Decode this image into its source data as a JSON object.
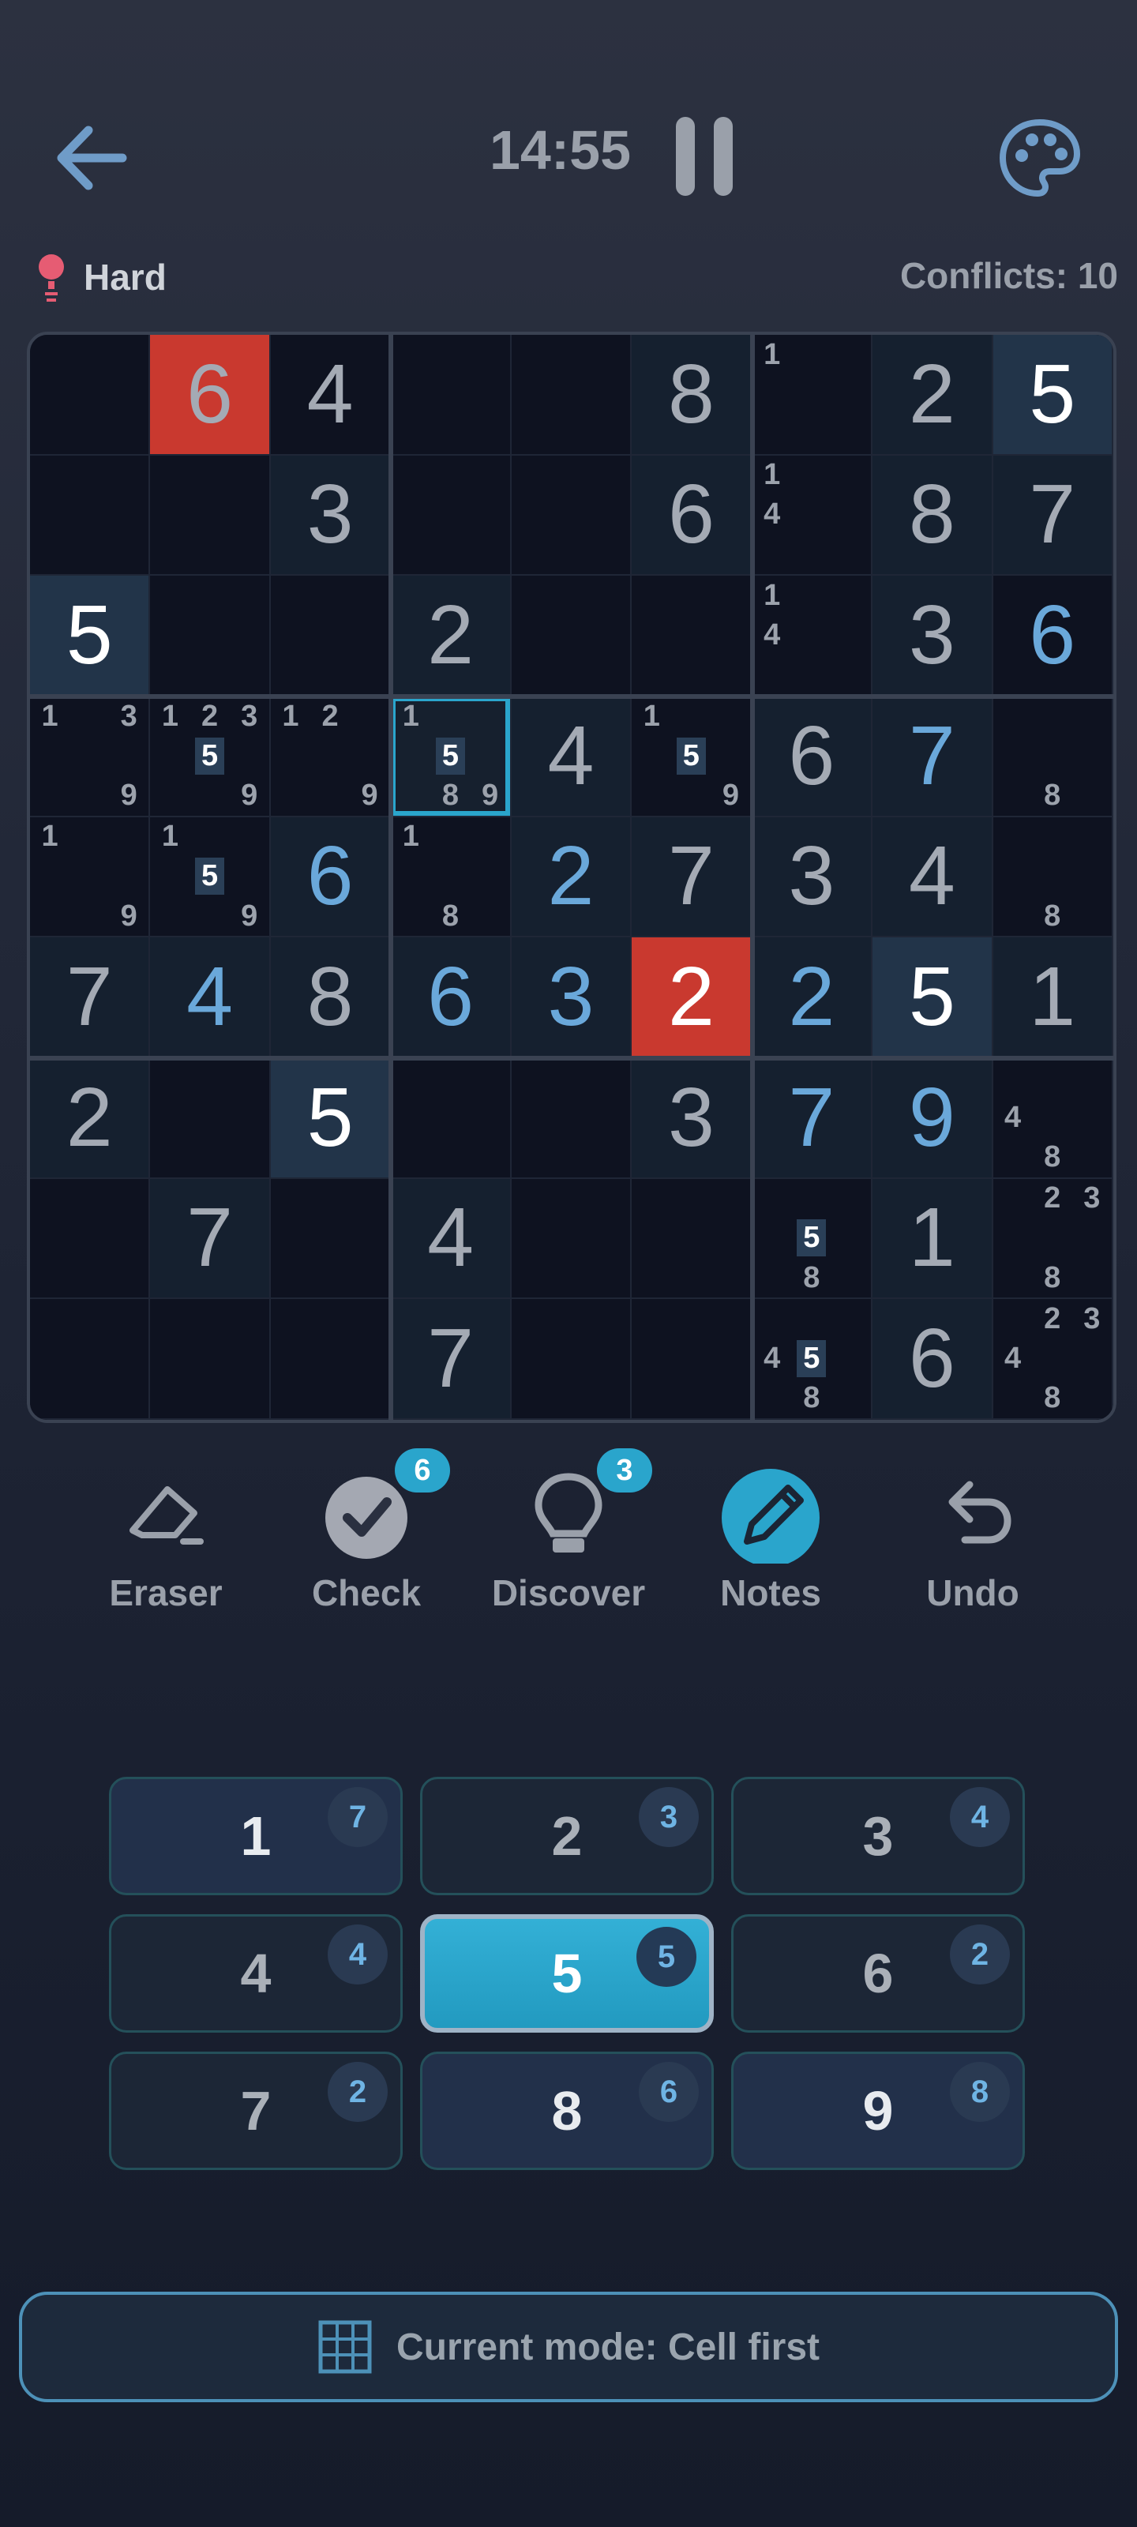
{
  "header": {
    "timer": "14:55",
    "difficulty": "Hard",
    "conflicts": "Conflicts: 10",
    "icons": [
      "back-arrow-icon",
      "pause-icon",
      "palette-icon",
      "bulb-pin-icon"
    ]
  },
  "board": {
    "cells": [
      [
        {
          "v": "",
          "s": ""
        },
        {
          "v": "6",
          "t": "given",
          "s": "conf"
        },
        {
          "v": "4",
          "t": "given"
        },
        {
          "v": ""
        },
        {
          "v": ""
        },
        {
          "v": "8",
          "t": "given",
          "s": "peer"
        },
        {
          "v": "",
          "n": [
            "1"
          ]
        },
        {
          "v": "2",
          "t": "given",
          "s": "peer"
        },
        {
          "v": "5",
          "t": "hl",
          "s": "same"
        }
      ],
      [
        {
          "v": ""
        },
        {
          "v": ""
        },
        {
          "v": "3",
          "t": "given",
          "s": "peer"
        },
        {
          "v": ""
        },
        {
          "v": ""
        },
        {
          "v": "6",
          "t": "given",
          "s": "peer"
        },
        {
          "v": "",
          "n": [
            "1",
            "4"
          ]
        },
        {
          "v": "8",
          "t": "given",
          "s": "peer"
        },
        {
          "v": "7",
          "t": "given",
          "s": "peer"
        }
      ],
      [
        {
          "v": "5",
          "t": "hl",
          "s": "same"
        },
        {
          "v": ""
        },
        {
          "v": ""
        },
        {
          "v": "2",
          "t": "given",
          "s": "peer"
        },
        {
          "v": ""
        },
        {
          "v": ""
        },
        {
          "v": "",
          "n": [
            "1",
            "4"
          ]
        },
        {
          "v": "3",
          "t": "given",
          "s": "peer"
        },
        {
          "v": "6",
          "t": "user"
        }
      ],
      [
        {
          "v": "",
          "n": [
            "1",
            "3",
            "9"
          ]
        },
        {
          "v": "",
          "n": [
            "1",
            "2",
            "3",
            "5",
            "9"
          ]
        },
        {
          "v": "",
          "n": [
            "1",
            "2",
            "9"
          ]
        },
        {
          "v": "",
          "n": [
            "1",
            "5",
            "8",
            "9"
          ],
          "s": "sel"
        },
        {
          "v": "4",
          "t": "given",
          "s": "peer"
        },
        {
          "v": "",
          "n": [
            "1",
            "5",
            "9"
          ]
        },
        {
          "v": "6",
          "t": "given",
          "s": "peer"
        },
        {
          "v": "7",
          "t": "user",
          "s": "peer"
        },
        {
          "v": "",
          "n": [
            "8"
          ]
        }
      ],
      [
        {
          "v": "",
          "n": [
            "1",
            "9"
          ]
        },
        {
          "v": "",
          "n": [
            "1",
            "5",
            "9"
          ]
        },
        {
          "v": "6",
          "t": "user",
          "s": "peer"
        },
        {
          "v": "",
          "n": [
            "1",
            "8"
          ]
        },
        {
          "v": "2",
          "t": "user",
          "s": "peer"
        },
        {
          "v": "7",
          "t": "given",
          "s": "peer"
        },
        {
          "v": "3",
          "t": "given",
          "s": "peer"
        },
        {
          "v": "4",
          "t": "given",
          "s": "peer"
        },
        {
          "v": "",
          "n": [
            "8"
          ]
        }
      ],
      [
        {
          "v": "7",
          "t": "given",
          "s": "peer"
        },
        {
          "v": "4",
          "t": "user",
          "s": "peer"
        },
        {
          "v": "8",
          "t": "given",
          "s": "peer"
        },
        {
          "v": "6",
          "t": "user",
          "s": "peer"
        },
        {
          "v": "3",
          "t": "user",
          "s": "peer"
        },
        {
          "v": "2",
          "t": "hl",
          "s": "conf"
        },
        {
          "v": "2",
          "t": "user",
          "s": "peer"
        },
        {
          "v": "5",
          "t": "hl",
          "s": "same"
        },
        {
          "v": "1",
          "t": "given",
          "s": "peer"
        }
      ],
      [
        {
          "v": "2",
          "t": "given",
          "s": "peer"
        },
        {
          "v": ""
        },
        {
          "v": "5",
          "t": "hl",
          "s": "same"
        },
        {
          "v": ""
        },
        {
          "v": ""
        },
        {
          "v": "3",
          "t": "given",
          "s": "peer"
        },
        {
          "v": "7",
          "t": "user",
          "s": "peer"
        },
        {
          "v": "9",
          "t": "user",
          "s": "peer"
        },
        {
          "v": "",
          "n": [
            "4",
            "8"
          ]
        }
      ],
      [
        {
          "v": ""
        },
        {
          "v": "7",
          "t": "given",
          "s": "peer"
        },
        {
          "v": ""
        },
        {
          "v": "4",
          "t": "given",
          "s": "peer"
        },
        {
          "v": ""
        },
        {
          "v": ""
        },
        {
          "v": "",
          "n": [
            "5",
            "8"
          ]
        },
        {
          "v": "1",
          "t": "given",
          "s": "peer"
        },
        {
          "v": "",
          "n": [
            "2",
            "3",
            "8"
          ]
        }
      ],
      [
        {
          "v": ""
        },
        {
          "v": ""
        },
        {
          "v": ""
        },
        {
          "v": "7",
          "t": "given",
          "s": "peer"
        },
        {
          "v": ""
        },
        {
          "v": ""
        },
        {
          "v": "",
          "n": [
            "4",
            "5",
            "8"
          ]
        },
        {
          "v": "6",
          "t": "given",
          "s": "peer"
        },
        {
          "v": "",
          "n": [
            "2",
            "3",
            "4",
            "8"
          ]
        }
      ]
    ]
  },
  "tools": [
    {
      "label": "Eraser",
      "icon": "eraser-icon"
    },
    {
      "label": "Check",
      "icon": "check-icon",
      "badge": "6"
    },
    {
      "label": "Discover",
      "icon": "lightbulb-icon",
      "badge": "3"
    },
    {
      "label": "Notes",
      "icon": "pencil-icon"
    },
    {
      "label": "Undo",
      "icon": "undo-icon"
    }
  ],
  "numpad": [
    {
      "digit": "1",
      "count": "7",
      "style": "strong"
    },
    {
      "digit": "2",
      "count": "3",
      "style": ""
    },
    {
      "digit": "3",
      "count": "4",
      "style": ""
    },
    {
      "digit": "4",
      "count": "4",
      "style": ""
    },
    {
      "digit": "5",
      "count": "5",
      "style": "active"
    },
    {
      "digit": "6",
      "count": "2",
      "style": ""
    },
    {
      "digit": "7",
      "count": "2",
      "style": ""
    },
    {
      "digit": "8",
      "count": "6",
      "style": "strong"
    },
    {
      "digit": "9",
      "count": "8",
      "style": "strong"
    }
  ],
  "mode_bar": {
    "label": "Current mode: Cell first",
    "icon": "grid-icon"
  },
  "colors": {
    "accent": "#2aa5cc",
    "conflict": "#c9392f",
    "user_digit": "#6aa8da"
  }
}
